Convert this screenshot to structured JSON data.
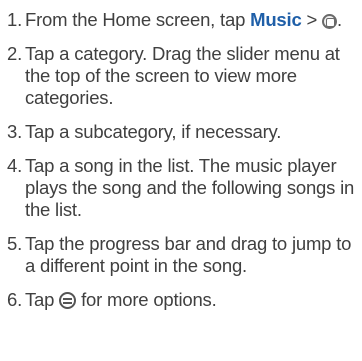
{
  "steps": [
    {
      "number": "1.",
      "text_before": "From the Home screen, tap ",
      "keyword": "Music",
      "text_after": " > ",
      "text_end": ".",
      "icon": "music-app-icon"
    },
    {
      "number": "2.",
      "text": "Tap a category. Drag the slider menu at the top of the screen to view more categories."
    },
    {
      "number": "3.",
      "text": "Tap a subcategory, if necessary."
    },
    {
      "number": "4.",
      "text": "Tap a song in the list. The music player plays the song and the following songs in the list."
    },
    {
      "number": "5.",
      "text": "Tap the progress bar and drag to jump to a different point in the song."
    },
    {
      "number": "6.",
      "text_before": "Tap ",
      "text_after": " for more options.",
      "icon": "menu-icon"
    }
  ],
  "colors": {
    "text": "#404040",
    "keyword": "#1f5fa8"
  }
}
